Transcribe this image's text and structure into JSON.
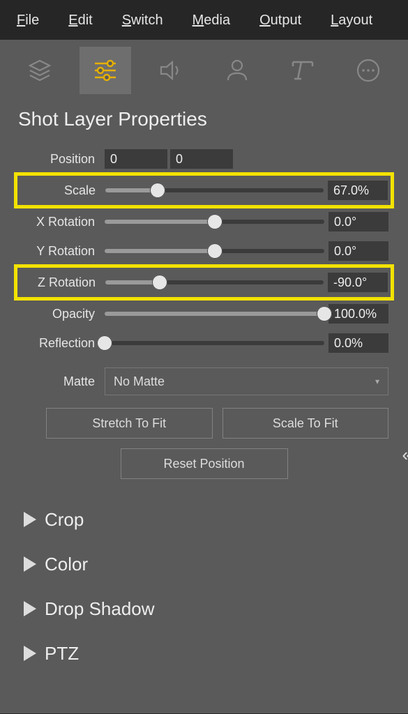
{
  "menus": {
    "file": "File",
    "edit": "Edit",
    "switch": "Switch",
    "media": "Media",
    "output": "Output",
    "layout": "Layout"
  },
  "title": "Shot Layer Properties",
  "position": {
    "label": "Position",
    "x": "0",
    "y": "0"
  },
  "sliders": {
    "scale": {
      "label": "Scale",
      "value": "67.0%",
      "pct": 24,
      "highlight": true
    },
    "xrotation": {
      "label": "X Rotation",
      "value": "0.0°",
      "pct": 50,
      "highlight": false
    },
    "yrotation": {
      "label": "Y Rotation",
      "value": "0.0°",
      "pct": 50,
      "highlight": false
    },
    "zrotation": {
      "label": "Z Rotation",
      "value": "-90.0°",
      "pct": 25,
      "highlight": true
    },
    "opacity": {
      "label": "Opacity",
      "value": "100.0%",
      "pct": 100,
      "highlight": false
    },
    "reflection": {
      "label": "Reflection",
      "value": "0.0%",
      "pct": 0,
      "highlight": false
    }
  },
  "matte": {
    "label": "Matte",
    "value": "No Matte"
  },
  "buttons": {
    "stretch": "Stretch To Fit",
    "scale": "Scale To Fit",
    "reset": "Reset Position"
  },
  "sections": {
    "crop": "Crop",
    "color": "Color",
    "dropshadow": "Drop Shadow",
    "ptz": "PTZ"
  }
}
